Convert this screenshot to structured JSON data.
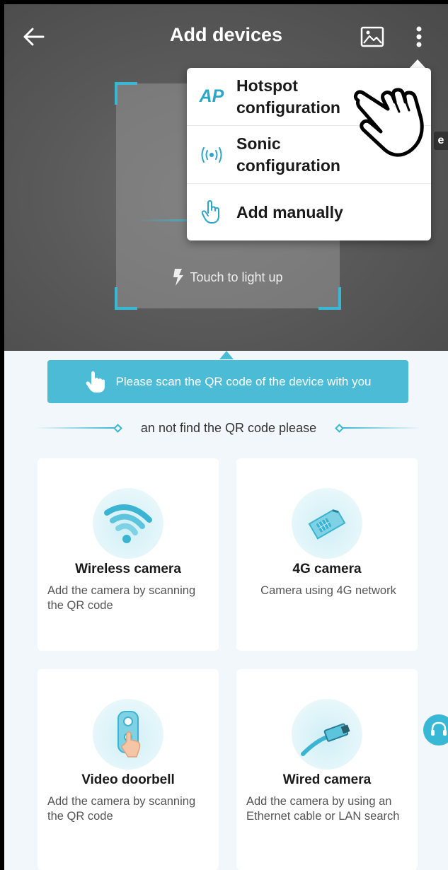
{
  "header": {
    "title": "Add devices",
    "back_icon": "arrow-left-icon",
    "gallery_icon": "image-icon",
    "more_icon": "more-vertical-icon"
  },
  "scanner": {
    "light_label": "Touch to light up",
    "edge_text": "e"
  },
  "menu": {
    "items": [
      {
        "icon_text": "AP",
        "label": "Hotspot configuration",
        "icon": "ap-icon"
      },
      {
        "label": "Sonic configuration",
        "icon": "sonic-wave-icon"
      },
      {
        "label": "Add manually",
        "icon": "hand-pointer-icon"
      }
    ]
  },
  "banner": {
    "text": "Please scan the QR code of the device with you"
  },
  "divider": {
    "text": "an not find the QR code please"
  },
  "cards": [
    {
      "title": "Wireless camera",
      "desc": "Add the camera by scanning the QR code",
      "icon": "wifi-icon"
    },
    {
      "title": "4G camera",
      "desc": "Camera using 4G network",
      "icon": "sim-card-icon"
    },
    {
      "title": "Video doorbell",
      "desc": "Add the camera by scanning the QR code",
      "icon": "doorbell-icon"
    },
    {
      "title": "Wired camera",
      "desc": "Add the camera by using an Ethernet cable  or LAN search",
      "icon": "ethernet-cable-icon"
    }
  ],
  "colors": {
    "accent": "#38b8d4",
    "banner": "#4cbcd6",
    "background": "#f2f7fb"
  }
}
